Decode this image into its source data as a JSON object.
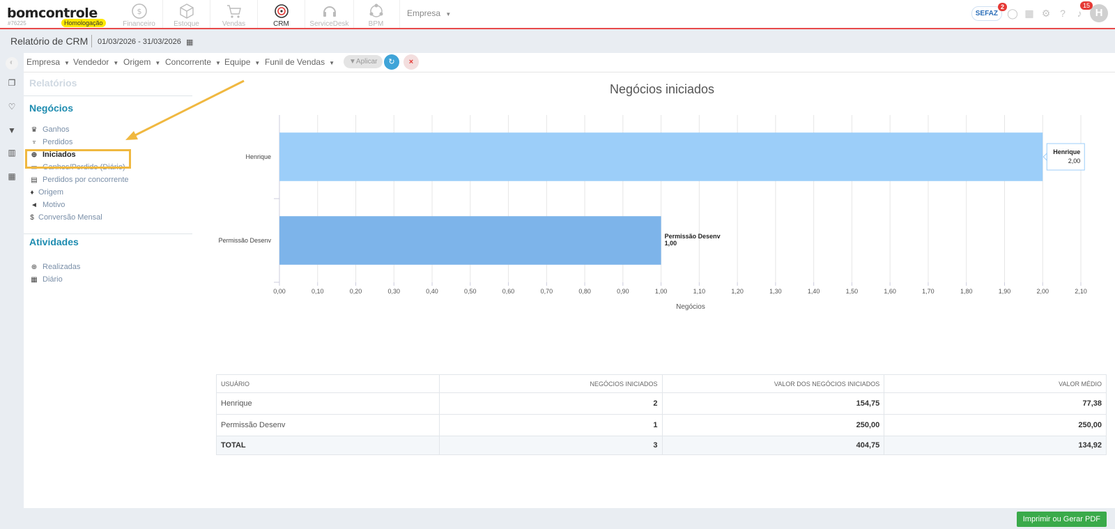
{
  "app": {
    "logo": "bomcontrole",
    "account_id": "#76225",
    "environment_badge": "Homologação"
  },
  "nav": [
    {
      "label": "Financeiro",
      "icon": "dollar-icon"
    },
    {
      "label": "Estoque",
      "icon": "box-icon"
    },
    {
      "label": "Vendas",
      "icon": "cart-icon"
    },
    {
      "label": "CRM",
      "icon": "target-icon",
      "active": true
    },
    {
      "label": "ServiceDesk",
      "icon": "headset-icon"
    },
    {
      "label": "BPM",
      "icon": "bpm-icon"
    }
  ],
  "company_selector": "Empresa",
  "top_right": {
    "sefaz_label": "SEFAZ",
    "sefaz_badge": "2",
    "notifications_badge": "15",
    "avatar_initial": "H"
  },
  "subheader": {
    "title": "Relatório de CRM",
    "date_range": "01/03/2026 - 31/03/2026"
  },
  "filters": {
    "items": [
      "Empresa",
      "Vendedor",
      "Origem",
      "Concorrente",
      "Equipe",
      "Funil de Vendas"
    ],
    "apply_label": "Aplicar"
  },
  "sidebar": {
    "relatorios_title": "Relatórios",
    "negocios_title": "Negócios",
    "negocios_items": [
      {
        "label": "Ganhos",
        "icon": "trophy-icon"
      },
      {
        "label": "Perdidos",
        "icon": "thumbs-down-icon"
      },
      {
        "label": "Iniciados",
        "icon": "plus-circle-icon",
        "selected": true
      },
      {
        "label": "Ganhos/Perdido (Diário)",
        "icon": "calendar-minus-icon"
      },
      {
        "label": "Perdidos por concorrente",
        "icon": "building-icon"
      },
      {
        "label": "Origem",
        "icon": "map-marker-icon"
      },
      {
        "label": "Motivo",
        "icon": "bullhorn-icon"
      },
      {
        "label": "Conversão Mensal",
        "icon": "dollar-sign-icon"
      }
    ],
    "atividades_title": "Atividades",
    "atividades_items": [
      {
        "label": "Realizadas",
        "icon": "plus-circle-icon"
      },
      {
        "label": "Diário",
        "icon": "calendar-icon"
      }
    ]
  },
  "chart_data": {
    "type": "bar",
    "orientation": "horizontal",
    "title": "Negócios iniciados",
    "xlabel": "Negócios",
    "ylabel": "",
    "categories": [
      "Henrique",
      "Permissão Desenv"
    ],
    "values": [
      2,
      1
    ],
    "value_labels": [
      "2,00",
      "1,00"
    ],
    "xlim": [
      0,
      2.1
    ],
    "x_ticks": [
      "0,00",
      "0,10",
      "0,20",
      "0,30",
      "0,40",
      "0,50",
      "0,60",
      "0,70",
      "0,80",
      "0,90",
      "1,00",
      "1,10",
      "1,20",
      "1,30",
      "1,40",
      "1,50",
      "1,60",
      "1,70",
      "1,80",
      "1,90",
      "2,00",
      "2,10"
    ],
    "colors": [
      "#9ccef9",
      "#7db4ea"
    ],
    "grid": true,
    "tooltip": {
      "category": "Henrique",
      "value": "2,00"
    }
  },
  "table": {
    "headers": [
      "USUÁRIO",
      "NEGÓCIOS INICIADOS",
      "VALOR DOS NEGÓCIOS INICIADOS",
      "VALOR MÉDIO"
    ],
    "rows": [
      [
        "Henrique",
        "2",
        "154,75",
        "77,38"
      ],
      [
        "Permissão Desenv",
        "1",
        "250,00",
        "250,00"
      ]
    ],
    "total": [
      "TOTAL",
      "3",
      "404,75",
      "134,92"
    ]
  },
  "footer": {
    "pdf_button": "Imprimir ou Gerar PDF"
  },
  "colors": {
    "accent_red": "#e84a4a",
    "section_blue": "#1e8cb0",
    "highlight_yellow": "#f0b840",
    "pdf_green": "#3aaa4a"
  }
}
